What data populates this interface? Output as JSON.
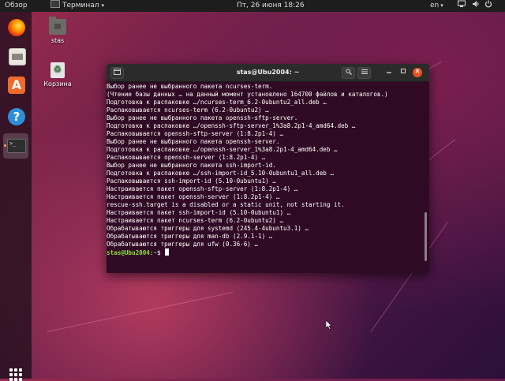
{
  "topbar": {
    "activities": "Обзор",
    "app_name": "Терминал",
    "app_caret": "▾",
    "clock": "Пт, 26 июня  18:26",
    "lang": "en",
    "lang_caret": "▾",
    "net_icon": "network-icon",
    "volume_icon": "volume-icon",
    "power_icon": "power-icon"
  },
  "dock": {
    "items": [
      {
        "name": "firefox",
        "icon": "firefox-icon"
      },
      {
        "name": "files",
        "icon": "files-icon"
      },
      {
        "name": "software",
        "icon": "software-center-icon",
        "glyph": "A"
      },
      {
        "name": "help",
        "icon": "help-icon",
        "glyph": "?"
      },
      {
        "name": "terminal",
        "icon": "terminal-icon",
        "glyph": ">_"
      }
    ],
    "apps_grid_icon": "show-applications-icon"
  },
  "desktop": {
    "icons": [
      {
        "label": "stas",
        "icon": "folder-icon"
      },
      {
        "label": "Корзина",
        "icon": "trash-icon"
      }
    ]
  },
  "terminal": {
    "title": "stas@Ubu2004: ~",
    "lines": [
      "Выбор ранее не выбранного пакета ncurses-term.",
      "(Чтение базы данных … на данный момент установлено 164700 файлов и каталогов.)",
      "Подготовка к распаковке …/ncurses-term_6.2-0ubuntu2_all.deb …",
      "Распаковывается ncurses-term (6.2-0ubuntu2) …",
      "Выбор ранее не выбранного пакета openssh-sftp-server.",
      "Подготовка к распаковке …/openssh-sftp-server_1%3a8.2p1-4_amd64.deb …",
      "Распаковывается openssh-sftp-server (1:8.2p1-4) …",
      "Выбор ранее не выбранного пакета openssh-server.",
      "Подготовка к распаковке …/openssh-server_1%3a8.2p1-4_amd64.deb …",
      "Распаковывается openssh-server (1:8.2p1-4) …",
      "Выбор ранее не выбранного пакета ssh-import-id.",
      "Подготовка к распаковке …/ssh-import-id_5.10-0ubuntu1_all.deb …",
      "Распаковывается ssh-import-id (5.10-0ubuntu1) …",
      "Настраивается пакет openssh-sftp-server (1:8.2p1-4) …",
      "Настраивается пакет openssh-server (1:8.2p1-4) …",
      "rescue-ssh.target is a disabled or a static unit, not starting it.",
      "Настраивается пакет ssh-import-id (5.10-0ubuntu1) …",
      "Настраивается пакет ncurses-term (6.2-0ubuntu2) …",
      "Обрабатываются триггеры для systemd (245.4-4ubuntu3.1) …",
      "Обрабатываются триггеры для man-db (2.9.1-1) …",
      "Обрабатываются триггеры для ufw (0.36-6) …"
    ],
    "prompt_user": "stas@Ubu2004",
    "prompt_sep": ":",
    "prompt_path": "~",
    "prompt_symbol": "$ ",
    "colors": {
      "background": "#300a24",
      "prompt_user": "#8ae234",
      "prompt_path": "#729fcf",
      "close_button": "#e95420"
    }
  }
}
